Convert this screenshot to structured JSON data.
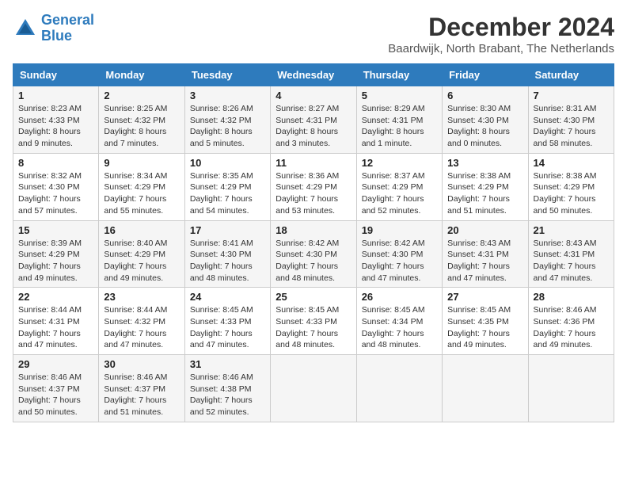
{
  "header": {
    "logo_line1": "General",
    "logo_line2": "Blue",
    "main_title": "December 2024",
    "subtitle": "Baardwijk, North Brabant, The Netherlands"
  },
  "weekdays": [
    "Sunday",
    "Monday",
    "Tuesday",
    "Wednesday",
    "Thursday",
    "Friday",
    "Saturday"
  ],
  "weeks": [
    [
      {
        "day": "1",
        "sunrise": "Sunrise: 8:23 AM",
        "sunset": "Sunset: 4:33 PM",
        "daylight": "Daylight: 8 hours and 9 minutes."
      },
      {
        "day": "2",
        "sunrise": "Sunrise: 8:25 AM",
        "sunset": "Sunset: 4:32 PM",
        "daylight": "Daylight: 8 hours and 7 minutes."
      },
      {
        "day": "3",
        "sunrise": "Sunrise: 8:26 AM",
        "sunset": "Sunset: 4:32 PM",
        "daylight": "Daylight: 8 hours and 5 minutes."
      },
      {
        "day": "4",
        "sunrise": "Sunrise: 8:27 AM",
        "sunset": "Sunset: 4:31 PM",
        "daylight": "Daylight: 8 hours and 3 minutes."
      },
      {
        "day": "5",
        "sunrise": "Sunrise: 8:29 AM",
        "sunset": "Sunset: 4:31 PM",
        "daylight": "Daylight: 8 hours and 1 minute."
      },
      {
        "day": "6",
        "sunrise": "Sunrise: 8:30 AM",
        "sunset": "Sunset: 4:30 PM",
        "daylight": "Daylight: 8 hours and 0 minutes."
      },
      {
        "day": "7",
        "sunrise": "Sunrise: 8:31 AM",
        "sunset": "Sunset: 4:30 PM",
        "daylight": "Daylight: 7 hours and 58 minutes."
      }
    ],
    [
      {
        "day": "8",
        "sunrise": "Sunrise: 8:32 AM",
        "sunset": "Sunset: 4:30 PM",
        "daylight": "Daylight: 7 hours and 57 minutes."
      },
      {
        "day": "9",
        "sunrise": "Sunrise: 8:34 AM",
        "sunset": "Sunset: 4:29 PM",
        "daylight": "Daylight: 7 hours and 55 minutes."
      },
      {
        "day": "10",
        "sunrise": "Sunrise: 8:35 AM",
        "sunset": "Sunset: 4:29 PM",
        "daylight": "Daylight: 7 hours and 54 minutes."
      },
      {
        "day": "11",
        "sunrise": "Sunrise: 8:36 AM",
        "sunset": "Sunset: 4:29 PM",
        "daylight": "Daylight: 7 hours and 53 minutes."
      },
      {
        "day": "12",
        "sunrise": "Sunrise: 8:37 AM",
        "sunset": "Sunset: 4:29 PM",
        "daylight": "Daylight: 7 hours and 52 minutes."
      },
      {
        "day": "13",
        "sunrise": "Sunrise: 8:38 AM",
        "sunset": "Sunset: 4:29 PM",
        "daylight": "Daylight: 7 hours and 51 minutes."
      },
      {
        "day": "14",
        "sunrise": "Sunrise: 8:38 AM",
        "sunset": "Sunset: 4:29 PM",
        "daylight": "Daylight: 7 hours and 50 minutes."
      }
    ],
    [
      {
        "day": "15",
        "sunrise": "Sunrise: 8:39 AM",
        "sunset": "Sunset: 4:29 PM",
        "daylight": "Daylight: 7 hours and 49 minutes."
      },
      {
        "day": "16",
        "sunrise": "Sunrise: 8:40 AM",
        "sunset": "Sunset: 4:29 PM",
        "daylight": "Daylight: 7 hours and 49 minutes."
      },
      {
        "day": "17",
        "sunrise": "Sunrise: 8:41 AM",
        "sunset": "Sunset: 4:30 PM",
        "daylight": "Daylight: 7 hours and 48 minutes."
      },
      {
        "day": "18",
        "sunrise": "Sunrise: 8:42 AM",
        "sunset": "Sunset: 4:30 PM",
        "daylight": "Daylight: 7 hours and 48 minutes."
      },
      {
        "day": "19",
        "sunrise": "Sunrise: 8:42 AM",
        "sunset": "Sunset: 4:30 PM",
        "daylight": "Daylight: 7 hours and 47 minutes."
      },
      {
        "day": "20",
        "sunrise": "Sunrise: 8:43 AM",
        "sunset": "Sunset: 4:31 PM",
        "daylight": "Daylight: 7 hours and 47 minutes."
      },
      {
        "day": "21",
        "sunrise": "Sunrise: 8:43 AM",
        "sunset": "Sunset: 4:31 PM",
        "daylight": "Daylight: 7 hours and 47 minutes."
      }
    ],
    [
      {
        "day": "22",
        "sunrise": "Sunrise: 8:44 AM",
        "sunset": "Sunset: 4:31 PM",
        "daylight": "Daylight: 7 hours and 47 minutes."
      },
      {
        "day": "23",
        "sunrise": "Sunrise: 8:44 AM",
        "sunset": "Sunset: 4:32 PM",
        "daylight": "Daylight: 7 hours and 47 minutes."
      },
      {
        "day": "24",
        "sunrise": "Sunrise: 8:45 AM",
        "sunset": "Sunset: 4:33 PM",
        "daylight": "Daylight: 7 hours and 47 minutes."
      },
      {
        "day": "25",
        "sunrise": "Sunrise: 8:45 AM",
        "sunset": "Sunset: 4:33 PM",
        "daylight": "Daylight: 7 hours and 48 minutes."
      },
      {
        "day": "26",
        "sunrise": "Sunrise: 8:45 AM",
        "sunset": "Sunset: 4:34 PM",
        "daylight": "Daylight: 7 hours and 48 minutes."
      },
      {
        "day": "27",
        "sunrise": "Sunrise: 8:45 AM",
        "sunset": "Sunset: 4:35 PM",
        "daylight": "Daylight: 7 hours and 49 minutes."
      },
      {
        "day": "28",
        "sunrise": "Sunrise: 8:46 AM",
        "sunset": "Sunset: 4:36 PM",
        "daylight": "Daylight: 7 hours and 49 minutes."
      }
    ],
    [
      {
        "day": "29",
        "sunrise": "Sunrise: 8:46 AM",
        "sunset": "Sunset: 4:37 PM",
        "daylight": "Daylight: 7 hours and 50 minutes."
      },
      {
        "day": "30",
        "sunrise": "Sunrise: 8:46 AM",
        "sunset": "Sunset: 4:37 PM",
        "daylight": "Daylight: 7 hours and 51 minutes."
      },
      {
        "day": "31",
        "sunrise": "Sunrise: 8:46 AM",
        "sunset": "Sunset: 4:38 PM",
        "daylight": "Daylight: 7 hours and 52 minutes."
      },
      null,
      null,
      null,
      null
    ]
  ]
}
